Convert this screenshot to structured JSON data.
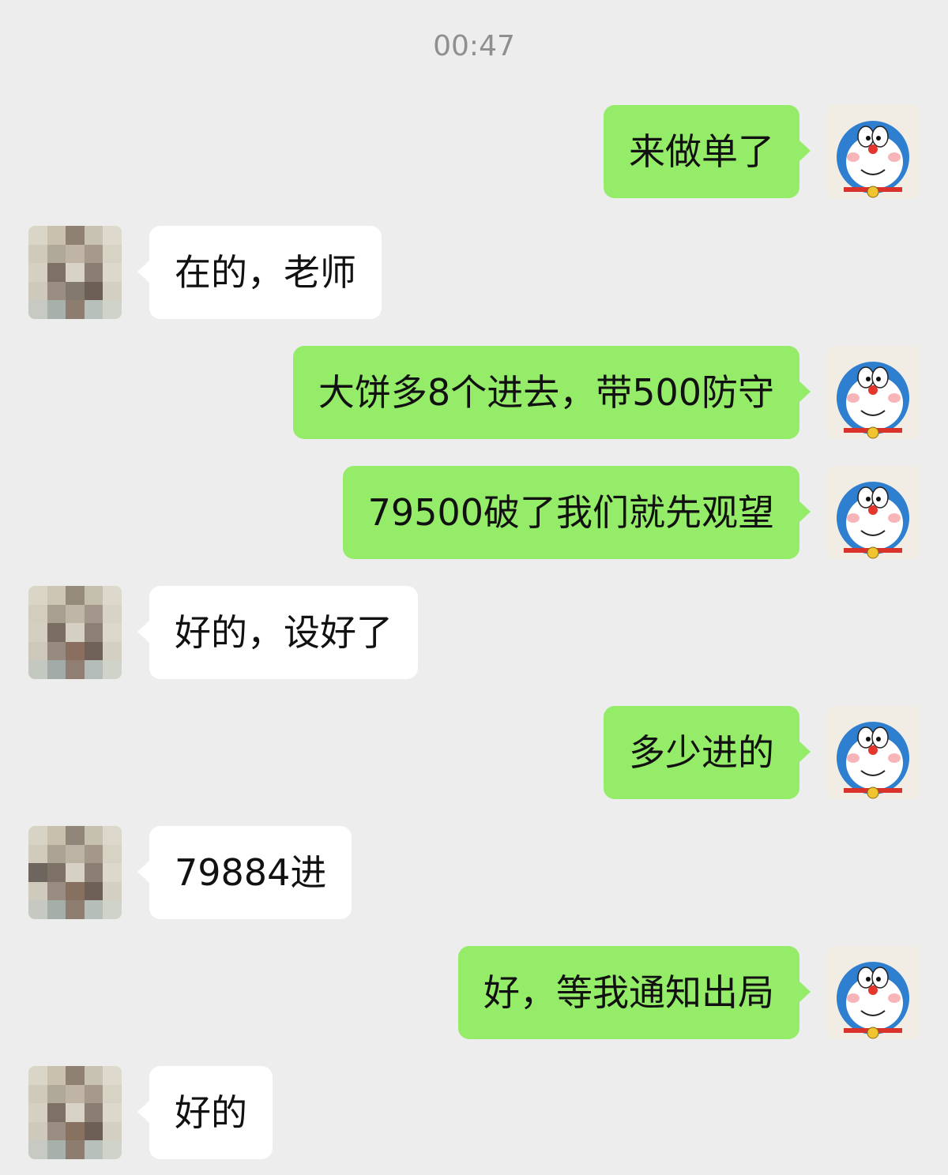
{
  "timestamp": "00:47",
  "messages": [
    {
      "side": "me",
      "text": "来做单了"
    },
    {
      "side": "other",
      "text": "在的，老师"
    },
    {
      "side": "me",
      "text": "大饼多8个进去，带500防守"
    },
    {
      "side": "me",
      "text": "79500破了我们就先观望"
    },
    {
      "side": "other",
      "text": "好的，设好了"
    },
    {
      "side": "me",
      "text": "多少进的"
    },
    {
      "side": "other",
      "text": "79884进"
    },
    {
      "side": "me",
      "text": "好，等我通知出局"
    },
    {
      "side": "other",
      "text": "好的"
    }
  ],
  "colors": {
    "background": "#ededed",
    "my_bubble": "#95ec69",
    "other_bubble": "#ffffff",
    "timestamp_text": "#8f8f8f"
  },
  "icons": {
    "my_avatar": "doraemon-avatar-icon",
    "other_avatar": "pixelated-avatar-icon"
  }
}
